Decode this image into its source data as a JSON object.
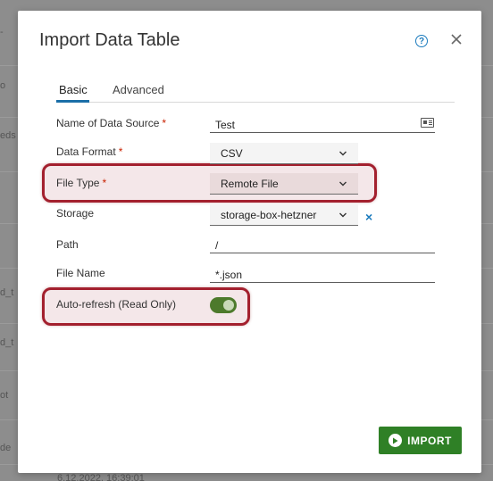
{
  "background": {
    "side_texts": [
      "-",
      "o",
      "eds",
      "d_t",
      "d_t",
      "ot",
      "de"
    ],
    "date_text": "6.12.2022, 16:39:01"
  },
  "dialog": {
    "title": "Import Data Table",
    "help_icon": "?",
    "tabs": [
      {
        "label": "Basic",
        "active": true
      },
      {
        "label": "Advanced",
        "active": false
      }
    ],
    "fields": {
      "name": {
        "label": "Name of Data Source",
        "required_mark": "*",
        "value": "Test"
      },
      "format": {
        "label": "Data Format",
        "required_mark": "*",
        "value": "CSV"
      },
      "file_type": {
        "label": "File Type",
        "required_mark": "*",
        "value": "Remote File"
      },
      "storage": {
        "label": "Storage",
        "value": "storage-box-hetzner",
        "clear_label": "×"
      },
      "path": {
        "label": "Path",
        "value": "/"
      },
      "file_name": {
        "label": "File Name",
        "value": "*.json"
      },
      "auto_refresh": {
        "label": "Auto-refresh (Read Only)",
        "enabled": true
      }
    },
    "import_button": "IMPORT"
  },
  "colors": {
    "primary_blue": "#1b6fa8",
    "success_green": "#2f8026",
    "toggle_green": "#4d7a2c",
    "highlight_red": "#a3202e",
    "required_red": "#c92100"
  }
}
